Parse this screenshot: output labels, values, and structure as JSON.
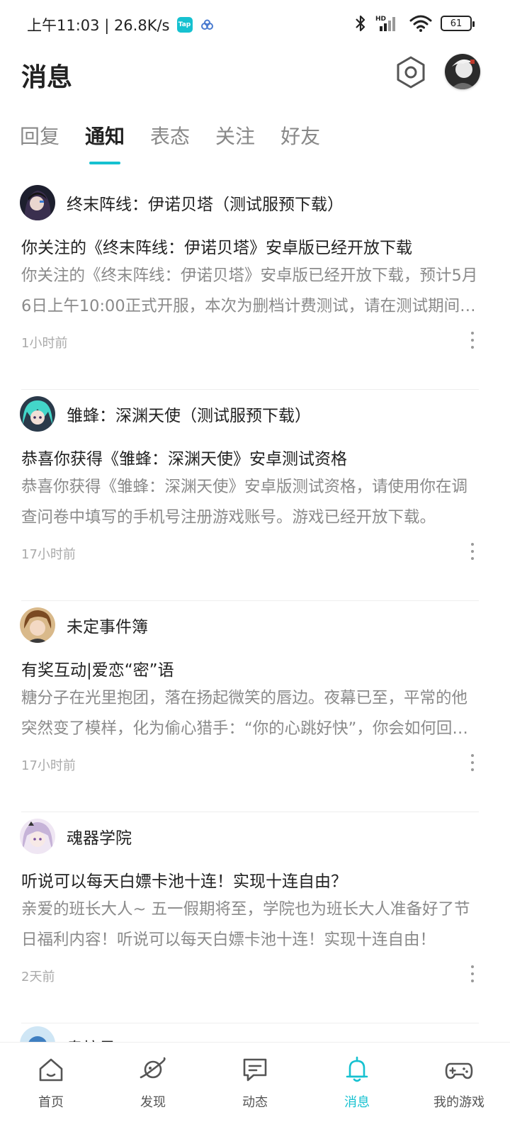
{
  "status_bar": {
    "time_speed": "上午11:03 | 26.8K/s",
    "tap_badge": "Tap",
    "network": "HD",
    "battery": "61"
  },
  "header": {
    "title": "消息"
  },
  "tabs": [
    {
      "label": "回复",
      "active": false
    },
    {
      "label": "通知",
      "active": true
    },
    {
      "label": "表态",
      "active": false
    },
    {
      "label": "关注",
      "active": false
    },
    {
      "label": "好友",
      "active": false
    }
  ],
  "notifications": [
    {
      "source": "终末阵线：伊诺贝塔（测试服预下载）",
      "title": "你关注的《终末阵线：伊诺贝塔》安卓版已经开放下载",
      "body": "你关注的《终末阵线：伊诺贝塔》安卓版已经开放下载，预计5月6日上午10:00正式开服，本次为删档计费测试，请在测试期间体验游戏内容。",
      "time": "1小时前"
    },
    {
      "source": "雏蜂：深渊天使（测试服预下载）",
      "title": "恭喜你获得《雏蜂：深渊天使》安卓测试资格",
      "body": "恭喜你获得《雏蜂：深渊天使》安卓版测试资格，请使用你在调查问卷中填写的手机号注册游戏账号。游戏已经开放下载。",
      "time": "17小时前"
    },
    {
      "source": "未定事件簿",
      "title": "有奖互动|爱恋“密”语",
      "body": "糖分子在光里抱团，落在扬起微笑的唇边。夜幕已至，平常的他突然变了模样，化为偷心猎手：“你的心跳好快”，你会如何回应？",
      "time": "17小时前"
    },
    {
      "source": "魂器学院",
      "title": "听说可以每天白嫖卡池十连！实现十连自由？",
      "body": "亲爱的班长大人~ 五一假期将至，学院也为班长大人准备好了节日福利内容！听说可以每天白嫖卡池十连！实现十连自由！",
      "time": "2天前"
    }
  ],
  "partial_item": {
    "source": "奥拉星"
  },
  "bottom_nav": [
    {
      "label": "首页",
      "icon": "home-icon",
      "active": false
    },
    {
      "label": "发现",
      "icon": "planet-icon",
      "active": false
    },
    {
      "label": "动态",
      "icon": "chat-bubble-icon",
      "active": false
    },
    {
      "label": "消息",
      "icon": "bell-icon",
      "active": true
    },
    {
      "label": "我的游戏",
      "icon": "gamepad-icon",
      "active": false
    }
  ],
  "colors": {
    "accent": "#16c1d0",
    "text_primary": "#222222",
    "text_secondary": "#8a8a8a",
    "text_muted": "#aaaaaa"
  }
}
